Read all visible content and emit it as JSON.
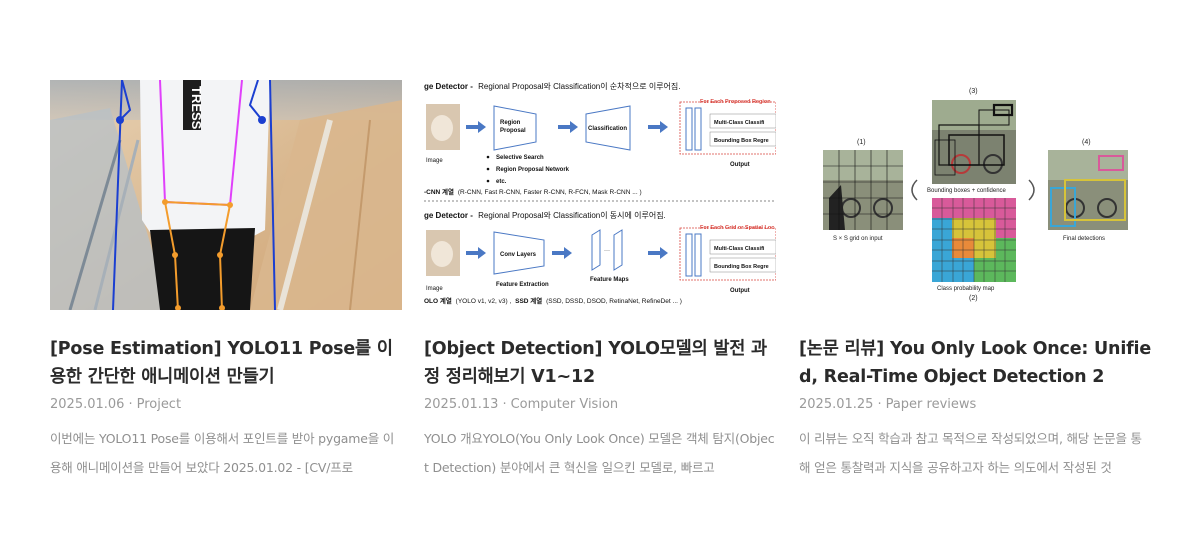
{
  "posts": [
    {
      "title": "[Pose Estimation] YOLO11 Pose를 이용한 간단한 애니메이션 만들기",
      "date": "2025.01.06",
      "category": "Project",
      "excerpt": "이번에는 YOLO11 Pose를 이용해서 포인트를 받아 pygame을 이용해 애니메이션을 만들어 보았다 2025.01.02 - [CV/프로"
    },
    {
      "title": "[Object Detection] YOLO모델의 발전 과정 정리해보기 V1~12",
      "date": "2025.01.13",
      "category": "Computer Vision",
      "excerpt": "YOLO 개요YOLO(You Only Look Once) 모델은 객체 탐지(Object Detection) 분야에서 큰 혁신을 일으킨 모델로, 빠르고",
      "diagram": {
        "top_heading_bold": "ge Detector -",
        "top_heading_rest": "Regional Proposal와 Classification이 순차적으로 이루어짐.",
        "image_label": "Image",
        "region_box": "Region Proposal",
        "classification_box": "Classification",
        "red_header_1": "For Each Proposed Region",
        "multi_class_1": "Multi-Class Classifi",
        "bbox_1": "Bounding Box Regre",
        "output_1": "Output",
        "bullets": [
          "Selective Search",
          "Region Proposal Network",
          "etc."
        ],
        "rcnn_bold": "-CNN 계열",
        "rcnn_rest": "(R-CNN, Fast R-CNN, Faster R-CNN, R-FCN, Mask R-CNN ... )",
        "bottom_heading_bold": "ge Detector -",
        "bottom_heading_rest": "Regional Proposal와 Classification이 동시에 이루어짐.",
        "conv_box": "Conv Layers",
        "feature_extraction": "Feature Extraction",
        "feature_maps": "Feature Maps",
        "red_header_2": "For Each Grid or Spatial Loc",
        "multi_class_2": "Multi-Class Classifi",
        "bbox_2": "Bounding Box Regre",
        "output_2": "Output",
        "image_label_2": "Image",
        "yolo_bold": "OLO 계열",
        "yolo_rest": "(YOLO v1, v2, v3) ,",
        "ssd_bold": "SSD 계열",
        "ssd_rest": "(SSD, DSSD, DSOD, RetinaNet, RefineDet ... )"
      }
    },
    {
      "title": "[논문 리뷰] You Only Look Once: Unified, Real-Time Object Detection 2",
      "date": "2025.01.25",
      "category": "Paper reviews",
      "excerpt": "이 리뷰는 오직 학습과 참고 목적으로 작성되었으며, 해당 논문을 통해 얻은 통찰력과 지식을 공유하고자 하는 의도에서 작성된 것",
      "diagram": {
        "label_1": "(1)",
        "label_2": "(2)",
        "label_3": "(3)",
        "label_4": "(4)",
        "grid_caption": "S × S grid on input",
        "boxes_caption": "Bounding boxes + confidence",
        "prob_caption": "Class probability map",
        "final_caption": "Final detections"
      }
    }
  ],
  "figure1": {
    "shirt_text": "TRESS"
  },
  "colors": {
    "title": "#2b2b2b",
    "meta": "#9a9a9a",
    "excerpt": "#8f8f8f",
    "diagram_blue": "#4a78c4",
    "diagram_red": "#d9463f"
  }
}
